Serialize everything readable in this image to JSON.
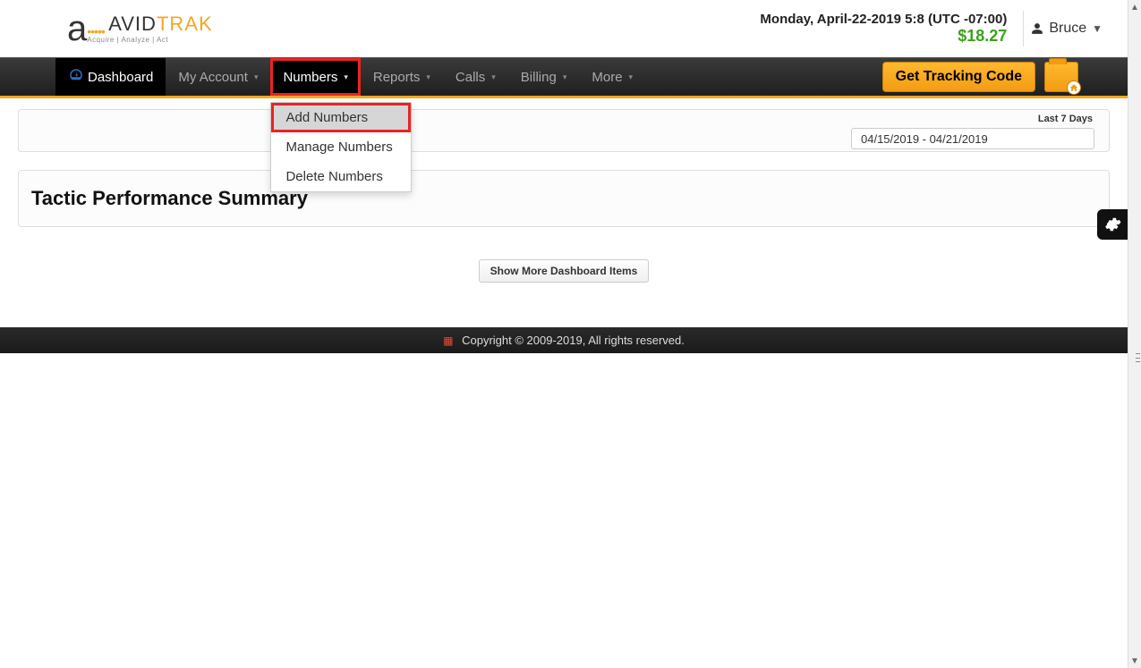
{
  "header": {
    "logo_brand1": "AVID",
    "logo_brand2": "TRAK",
    "logo_tagline": "Acquire | Analyze | Act",
    "datetime": "Monday, April-22-2019 5:8 (UTC -07:00)",
    "balance": "$18.27",
    "user_name": "Bruce"
  },
  "nav": {
    "dashboard": "Dashboard",
    "my_account": "My Account",
    "numbers": "Numbers",
    "reports": "Reports",
    "calls": "Calls",
    "billing": "Billing",
    "more": "More",
    "get_code": "Get Tracking Code"
  },
  "numbers_menu": {
    "items": [
      {
        "label": "Add Numbers"
      },
      {
        "label": "Manage Numbers"
      },
      {
        "label": "Delete Numbers"
      }
    ]
  },
  "filter": {
    "label": "Last 7 Days",
    "range": "04/15/2019 - 04/21/2019"
  },
  "summary": {
    "title": "Tactic Performance Summary"
  },
  "buttons": {
    "show_more": "Show More Dashboard Items"
  },
  "footer": {
    "copyright": "Copyright © 2009-2019, All rights reserved."
  }
}
